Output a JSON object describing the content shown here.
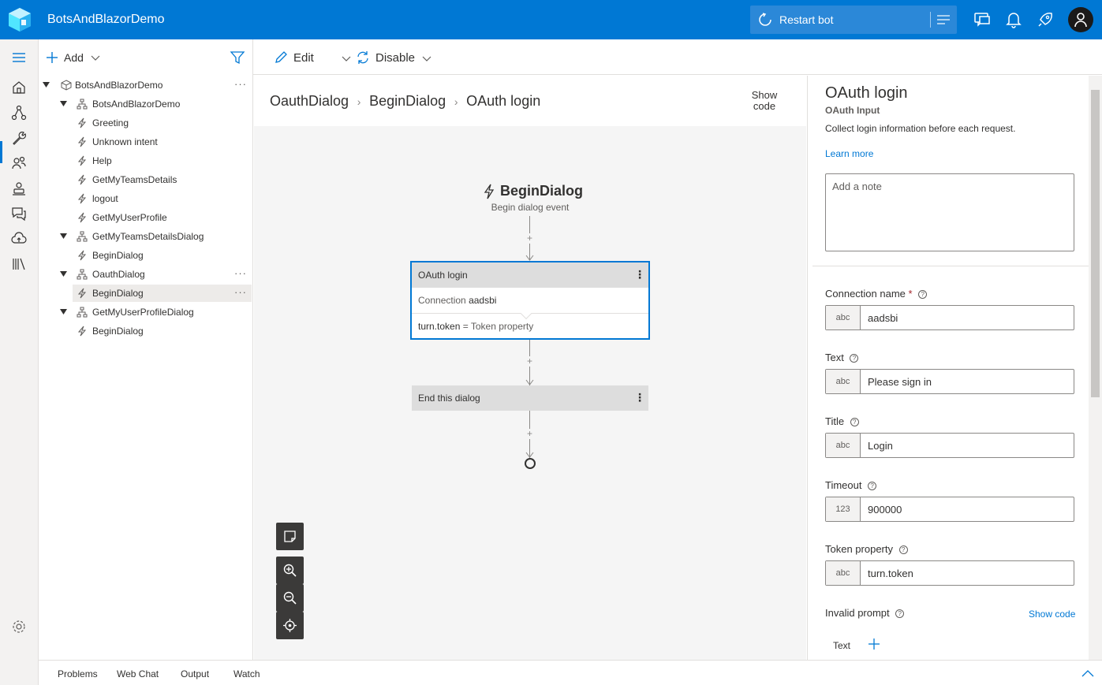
{
  "header": {
    "app_title": "BotsAndBlazorDemo",
    "restart_label": "Restart bot",
    "icons": [
      "webchat-icon",
      "bell-icon",
      "rocket-icon",
      "avatar"
    ]
  },
  "colors": {
    "accent": "#0078d4",
    "canvas_bg": "#f5f5f5",
    "card_header": "#dddddd"
  },
  "tree": {
    "add_label": "Add",
    "rows": [
      {
        "label": "BotsAndBlazorDemo",
        "kind": "bot",
        "level": 0,
        "caret": true,
        "more": true
      },
      {
        "label": "BotsAndBlazorDemo",
        "kind": "dialog",
        "level": 1,
        "caret": true
      },
      {
        "label": "Greeting",
        "kind": "trigger",
        "level": 2
      },
      {
        "label": "Unknown intent",
        "kind": "trigger",
        "level": 2
      },
      {
        "label": "Help",
        "kind": "trigger",
        "level": 2
      },
      {
        "label": "GetMyTeamsDetails",
        "kind": "trigger",
        "level": 2
      },
      {
        "label": "logout",
        "kind": "trigger",
        "level": 2
      },
      {
        "label": "GetMyUserProfile",
        "kind": "trigger",
        "level": 2
      },
      {
        "label": "GetMyTeamsDetailsDialog",
        "kind": "dialog",
        "level": 1,
        "caret": true
      },
      {
        "label": "BeginDialog",
        "kind": "trigger",
        "level": 2
      },
      {
        "label": "OauthDialog",
        "kind": "dialog",
        "level": 1,
        "caret": true,
        "more": true
      },
      {
        "label": "BeginDialog",
        "kind": "trigger",
        "level": 2,
        "selected": true,
        "more": true
      },
      {
        "label": "GetMyUserProfileDialog",
        "kind": "dialog",
        "level": 1,
        "caret": true
      },
      {
        "label": "BeginDialog",
        "kind": "trigger",
        "level": 2
      }
    ]
  },
  "toolbar": {
    "edit_label": "Edit",
    "disable_label": "Disable"
  },
  "canvas": {
    "breadcrumb": [
      "OauthDialog",
      "BeginDialog",
      "OAuth login"
    ],
    "show_code_line1": "Show",
    "show_code_line2": "code",
    "trigger_title": "BeginDialog",
    "trigger_subtitle": "Begin dialog event",
    "oauth_card": {
      "title": "OAuth login",
      "connection_key": "Connection",
      "connection_value": "aadsbi",
      "token_key": "turn.token",
      "token_eq": "=",
      "token_value": "Token property"
    },
    "end_card_title": "End this dialog"
  },
  "props": {
    "title": "OAuth login",
    "subtitle": "OAuth Input",
    "description": "Collect login information before each request.",
    "learn_more": "Learn more",
    "note_placeholder": "Add a note",
    "fields": {
      "connection": {
        "label": "Connection name",
        "required": "*",
        "type": "abc",
        "value": "aadsbi"
      },
      "text": {
        "label": "Text",
        "type": "abc",
        "value": "Please sign in"
      },
      "title": {
        "label": "Title",
        "type": "abc",
        "value": "Login"
      },
      "timeout": {
        "label": "Timeout",
        "type": "123",
        "value": "900000"
      },
      "token": {
        "label": "Token property",
        "type": "abc",
        "value": "turn.token"
      }
    },
    "invalid_prompt_label": "Invalid prompt",
    "show_code": "Show code",
    "text_tab": "Text"
  },
  "bottombar": {
    "tabs": [
      "Problems",
      "Web Chat",
      "Output",
      "Watch"
    ]
  }
}
